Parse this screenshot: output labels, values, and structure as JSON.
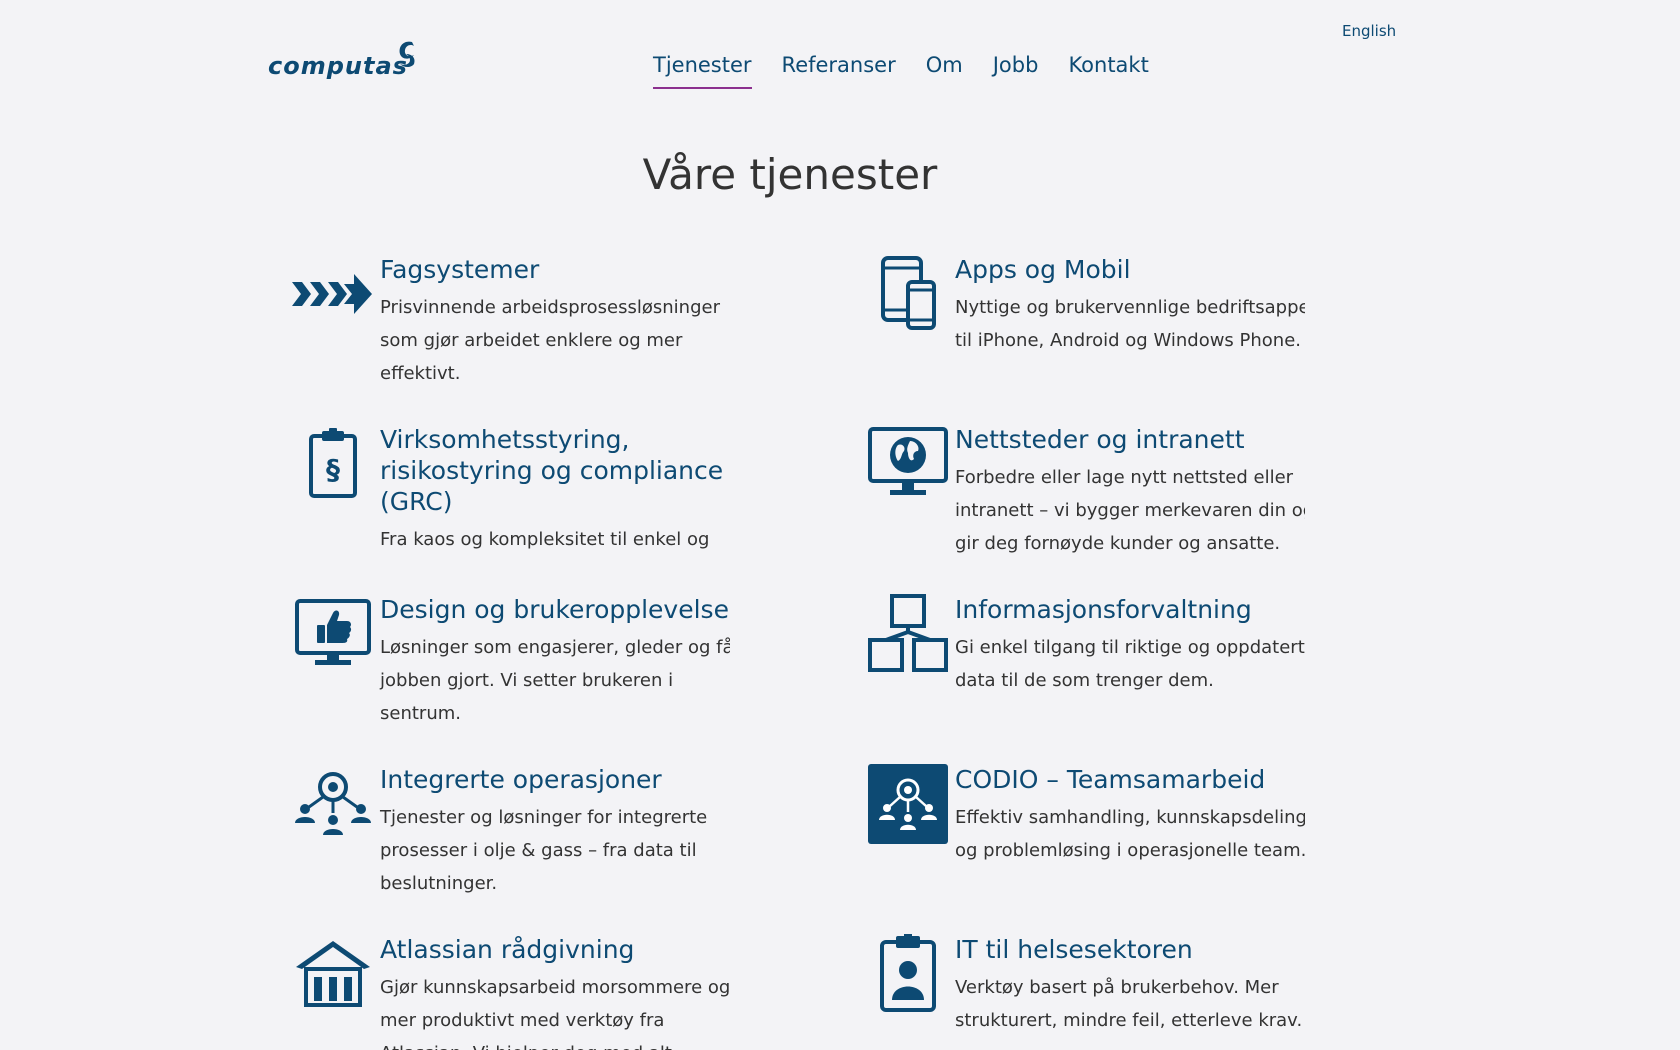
{
  "header": {
    "logo_text": "computas",
    "lang_link": "English",
    "nav": [
      {
        "label": "Tjenester",
        "active": true
      },
      {
        "label": "Referanser"
      },
      {
        "label": "Om"
      },
      {
        "label": "Jobb"
      },
      {
        "label": "Kontakt"
      }
    ]
  },
  "page_title": "Våre tjenester",
  "services": [
    {
      "icon": "arrows-right-icon",
      "title": "Fagsystemer",
      "description": "Prisvinnende arbeidsprosessløsninger som gjør arbeidet enklere og mer effektivt."
    },
    {
      "icon": "devices-icon",
      "title": "Apps og Mobil",
      "description": "Nyttige og brukervennlige bedriftsapper til iPhone, Android og Windows Phone."
    },
    {
      "icon": "clipboard-paragraph-icon",
      "title": "Virksomhetsstyring, risikostyring og compliance (GRC)",
      "description": "Fra kaos og kompleksitet til enkel og strukturert etterlevelse av krav og regler."
    },
    {
      "icon": "globe-monitor-icon",
      "title": "Nettsteder og intranett",
      "description": "Forbedre eller lage nytt nettsted eller intranett – vi bygger merkevaren din og gir deg fornøyde kunder og ansatte."
    },
    {
      "icon": "thumbs-up-monitor-icon",
      "title": "Design og brukeropplevelse",
      "description": "Løsninger som engasjerer, gleder og får jobben gjort. Vi setter brukeren i sentrum."
    },
    {
      "icon": "hierarchy-icon",
      "title": "Informasjonsforvaltning",
      "description": "Gi enkel tilgang til riktige og oppdaterte data til de som trenger dem."
    },
    {
      "icon": "network-people-icon",
      "title": "Integrerte operasjoner",
      "description": "Tjenester og løsninger for integrerte prosesser i olje & gass – fra data til beslutninger."
    },
    {
      "icon": "team-box-icon",
      "title": "CODIO – Teamsamarbeid",
      "description": "Effektiv samhandling, kunnskapsdeling og problemløsing i operasjonelle team."
    },
    {
      "icon": "building-icon",
      "title": "Atlassian rådgivning",
      "description": "Gjør kunnskapsarbeid morsommere og mer produktivt med verktøy fra Atlassian. Vi hjelper deg med alt."
    },
    {
      "icon": "badge-person-icon",
      "title": "IT til helsesektoren",
      "description": "Verktøy basert på brukerbehov. Mer strukturert, mindre feil, etterleve krav."
    }
  ]
}
